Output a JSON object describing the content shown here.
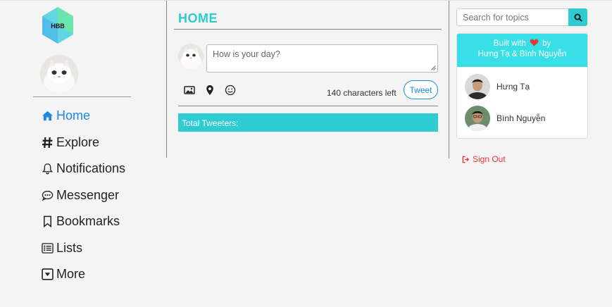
{
  "logo": {
    "text": "HBB"
  },
  "sidebar": {
    "items": [
      {
        "label": "Home",
        "icon": "home-icon",
        "active": true
      },
      {
        "label": "Explore",
        "icon": "hashtag-icon"
      },
      {
        "label": "Notifications",
        "icon": "bell-icon"
      },
      {
        "label": "Messenger",
        "icon": "chat-icon"
      },
      {
        "label": "Bookmarks",
        "icon": "bookmark-icon"
      },
      {
        "label": "Lists",
        "icon": "list-icon"
      },
      {
        "label": "More",
        "icon": "caret-square-icon"
      }
    ]
  },
  "main": {
    "title": "HOME",
    "compose": {
      "placeholder": "How is your day?",
      "chars_left": "140 characters left",
      "tweet_label": "Tweet"
    },
    "total_label": "Total Tweeters:"
  },
  "right": {
    "search_placeholder": "Search for topics",
    "credits": {
      "line1_prefix": "Built with",
      "line1_suffix": "by",
      "line2": "Hưng Tạ & Bình Nguyễn"
    },
    "members": [
      {
        "name": "Hưng Tạ"
      },
      {
        "name": "Bình Nguyễn"
      }
    ],
    "sign_out": "Sign Out"
  },
  "colors": {
    "accent": "#2ecbd1",
    "link": "#1e88e5",
    "danger": "#e53935",
    "card_header": "#37e0e6"
  }
}
